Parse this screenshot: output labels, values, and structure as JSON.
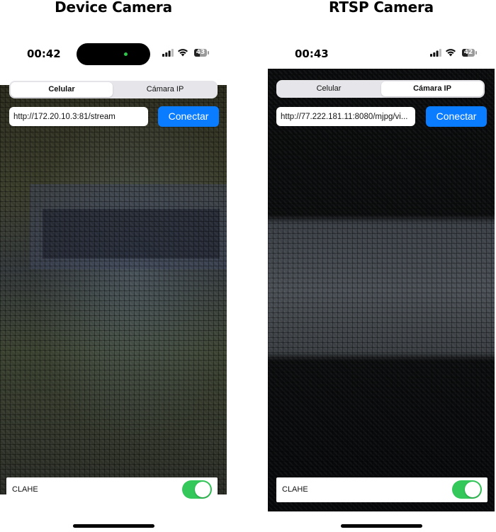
{
  "panels": [
    {
      "caption": "Device Camera",
      "status": {
        "time": "00:42",
        "battery": "43",
        "battery_level": 0.43
      },
      "segmented": {
        "options": [
          "Celular",
          "Cámara IP"
        ],
        "selected": "Celular"
      },
      "url": {
        "value": "http://172.20.10.3:81/stream"
      },
      "connect_label": "Conectar",
      "clahe": {
        "label": "CLAHE",
        "enabled": true
      }
    },
    {
      "caption": "RTSP Camera",
      "status": {
        "time": "00:43",
        "battery": "42",
        "battery_level": 0.42
      },
      "segmented": {
        "options": [
          "Celular",
          "Cámara IP"
        ],
        "selected": "Cámara IP"
      },
      "url": {
        "value": "http://77.222.181.11:8080/mjpg/vi..."
      },
      "connect_label": "Conectar",
      "clahe": {
        "label": "CLAHE",
        "enabled": true
      }
    }
  ],
  "colors": {
    "accent": "#0a7cff",
    "toggle_on": "#34c759",
    "camera_dot": "#2ec54a"
  },
  "icons": [
    "signal-icon",
    "wifi-icon",
    "battery-icon"
  ]
}
